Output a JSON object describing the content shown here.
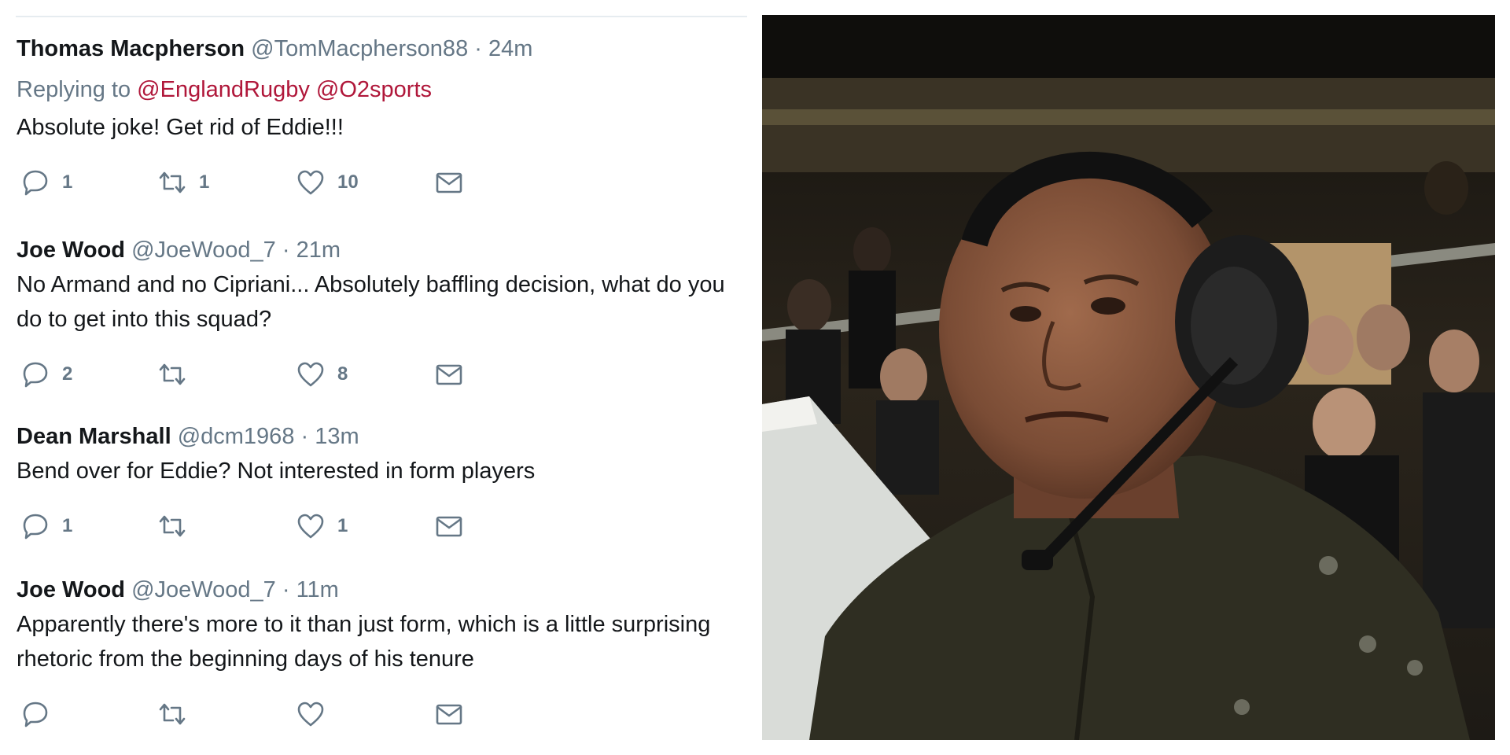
{
  "tweets": [
    {
      "name": "Thomas Macpherson",
      "handle": "@TomMacpherson88",
      "dot": "·",
      "time": "24m",
      "replying_prefix": "Replying to",
      "mention_1": "@EnglandRugby",
      "mention_2": "@O2sports",
      "text": "Absolute joke! Get rid of Eddie!!!",
      "reply_count": "1",
      "retweet_count": "1",
      "like_count": "10"
    },
    {
      "name": "Joe Wood",
      "handle": "@JoeWood_7",
      "dot": "·",
      "time": "21m",
      "text": "No Armand and no Cipriani... Absolutely baffling decision, what do you\ndo to get into this squad?",
      "reply_count": "2",
      "retweet_count": "",
      "like_count": "8"
    },
    {
      "name": "Dean Marshall",
      "handle": "@dcm1968",
      "dot": "·",
      "time": "13m",
      "text": "Bend over for Eddie? Not interested in form players",
      "reply_count": "1",
      "retweet_count": "",
      "like_count": "1"
    },
    {
      "name": "Joe Wood",
      "handle": "@JoeWood_7",
      "dot": "·",
      "time": "11m",
      "text": "Apparently there's more to it than just form, which is a little surprising\nrhetoric from the beginning days of his tenure",
      "reply_count": "",
      "retweet_count": "",
      "like_count": ""
    }
  ],
  "icons": {
    "reply": "reply-icon",
    "retweet": "retweet-icon",
    "like": "heart-icon",
    "dm": "envelope-icon"
  },
  "colors": {
    "mention": "#b0173a",
    "secondary_text": "#657786",
    "primary_text": "#14171a"
  }
}
